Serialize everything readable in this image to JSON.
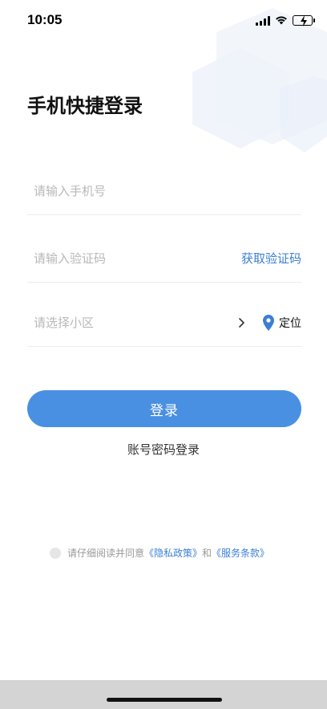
{
  "status_bar": {
    "time": "10:05"
  },
  "header": {
    "title": "手机快捷登录"
  },
  "form": {
    "phone_placeholder": "请输入手机号",
    "code_placeholder": "请输入验证码",
    "get_code_label": "获取验证码",
    "community_placeholder": "请选择小区",
    "locate_label": "定位"
  },
  "actions": {
    "login_label": "登录",
    "account_login_label": "账号密码登录"
  },
  "agreement": {
    "prefix": "请仔细阅读并同意",
    "privacy_label": "《隐私政策》",
    "and": "和",
    "terms_label": "《服务条款》"
  },
  "colors": {
    "accent": "#4a90e2",
    "link": "#3b7fd4",
    "placeholder": "#b8b8b8"
  },
  "icons": [
    "signal-icon",
    "wifi-icon",
    "battery-icon",
    "chevron-right-icon",
    "location-pin-icon"
  ]
}
